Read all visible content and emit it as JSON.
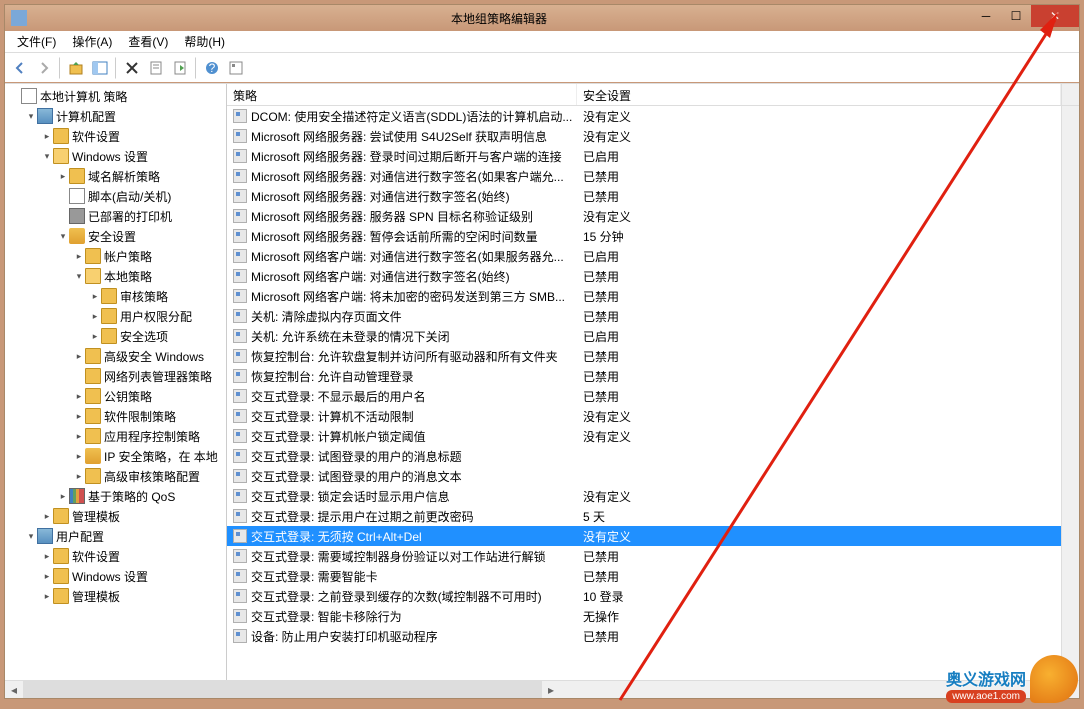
{
  "window": {
    "title": "本地组策略编辑器"
  },
  "menu": [
    {
      "label": "文件(F)"
    },
    {
      "label": "操作(A)"
    },
    {
      "label": "查看(V)"
    },
    {
      "label": "帮助(H)"
    }
  ],
  "tree": [
    {
      "indent": 0,
      "arrow": "",
      "icon": "doc",
      "label": "本地计算机 策略"
    },
    {
      "indent": 1,
      "arrow": "▾",
      "icon": "computer",
      "label": "计算机配置"
    },
    {
      "indent": 2,
      "arrow": "▸",
      "icon": "folder",
      "label": "软件设置"
    },
    {
      "indent": 2,
      "arrow": "▾",
      "icon": "folder-open",
      "label": "Windows 设置"
    },
    {
      "indent": 3,
      "arrow": "▸",
      "icon": "folder",
      "label": "域名解析策略"
    },
    {
      "indent": 3,
      "arrow": "",
      "icon": "doc",
      "label": "脚本(启动/关机)"
    },
    {
      "indent": 3,
      "arrow": "",
      "icon": "printer",
      "label": "已部署的打印机"
    },
    {
      "indent": 3,
      "arrow": "▾",
      "icon": "shield",
      "label": "安全设置"
    },
    {
      "indent": 4,
      "arrow": "▸",
      "icon": "folder",
      "label": "帐户策略"
    },
    {
      "indent": 4,
      "arrow": "▾",
      "icon": "folder-open",
      "label": "本地策略"
    },
    {
      "indent": 5,
      "arrow": "▸",
      "icon": "folder",
      "label": "审核策略"
    },
    {
      "indent": 5,
      "arrow": "▸",
      "icon": "folder",
      "label": "用户权限分配"
    },
    {
      "indent": 5,
      "arrow": "▸",
      "icon": "folder",
      "label": "安全选项"
    },
    {
      "indent": 4,
      "arrow": "▸",
      "icon": "folder",
      "label": "高级安全 Windows"
    },
    {
      "indent": 4,
      "arrow": "",
      "icon": "folder",
      "label": "网络列表管理器策略"
    },
    {
      "indent": 4,
      "arrow": "▸",
      "icon": "folder",
      "label": "公钥策略"
    },
    {
      "indent": 4,
      "arrow": "▸",
      "icon": "folder",
      "label": "软件限制策略"
    },
    {
      "indent": 4,
      "arrow": "▸",
      "icon": "folder",
      "label": "应用程序控制策略"
    },
    {
      "indent": 4,
      "arrow": "▸",
      "icon": "shield",
      "label": "IP 安全策略，在 本地"
    },
    {
      "indent": 4,
      "arrow": "▸",
      "icon": "folder",
      "label": "高级审核策略配置"
    },
    {
      "indent": 3,
      "arrow": "▸",
      "icon": "chart",
      "label": "基于策略的 QoS"
    },
    {
      "indent": 2,
      "arrow": "▸",
      "icon": "folder",
      "label": "管理模板"
    },
    {
      "indent": 1,
      "arrow": "▾",
      "icon": "computer",
      "label": "用户配置"
    },
    {
      "indent": 2,
      "arrow": "▸",
      "icon": "folder",
      "label": "软件设置"
    },
    {
      "indent": 2,
      "arrow": "▸",
      "icon": "folder",
      "label": "Windows 设置"
    },
    {
      "indent": 2,
      "arrow": "▸",
      "icon": "folder",
      "label": "管理模板"
    }
  ],
  "columns": {
    "c1": "策略",
    "c2": "安全设置"
  },
  "rows": [
    {
      "p": "DCOM: 使用安全描述符定义语言(SDDL)语法的计算机启动...",
      "s": "没有定义"
    },
    {
      "p": "Microsoft 网络服务器: 尝试使用 S4U2Self 获取声明信息",
      "s": "没有定义"
    },
    {
      "p": "Microsoft 网络服务器: 登录时间过期后断开与客户端的连接",
      "s": "已启用"
    },
    {
      "p": "Microsoft 网络服务器: 对通信进行数字签名(如果客户端允...",
      "s": "已禁用"
    },
    {
      "p": "Microsoft 网络服务器: 对通信进行数字签名(始终)",
      "s": "已禁用"
    },
    {
      "p": "Microsoft 网络服务器: 服务器 SPN 目标名称验证级别",
      "s": "没有定义"
    },
    {
      "p": "Microsoft 网络服务器: 暂停会话前所需的空闲时间数量",
      "s": "15 分钟"
    },
    {
      "p": "Microsoft 网络客户端: 对通信进行数字签名(如果服务器允...",
      "s": "已启用"
    },
    {
      "p": "Microsoft 网络客户端: 对通信进行数字签名(始终)",
      "s": "已禁用"
    },
    {
      "p": "Microsoft 网络客户端: 将未加密的密码发送到第三方 SMB...",
      "s": "已禁用"
    },
    {
      "p": "关机: 清除虚拟内存页面文件",
      "s": "已禁用"
    },
    {
      "p": "关机: 允许系统在未登录的情况下关闭",
      "s": "已启用"
    },
    {
      "p": "恢复控制台: 允许软盘复制并访问所有驱动器和所有文件夹",
      "s": "已禁用"
    },
    {
      "p": "恢复控制台: 允许自动管理登录",
      "s": "已禁用"
    },
    {
      "p": "交互式登录: 不显示最后的用户名",
      "s": "已禁用"
    },
    {
      "p": "交互式登录: 计算机不活动限制",
      "s": "没有定义"
    },
    {
      "p": "交互式登录: 计算机帐户锁定阈值",
      "s": "没有定义"
    },
    {
      "p": "交互式登录: 试图登录的用户的消息标题",
      "s": ""
    },
    {
      "p": "交互式登录: 试图登录的用户的消息文本",
      "s": ""
    },
    {
      "p": "交互式登录: 锁定会话时显示用户信息",
      "s": "没有定义"
    },
    {
      "p": "交互式登录: 提示用户在过期之前更改密码",
      "s": "5 天"
    },
    {
      "p": "交互式登录: 无须按 Ctrl+Alt+Del",
      "s": "没有定义",
      "selected": true
    },
    {
      "p": "交互式登录: 需要域控制器身份验证以对工作站进行解锁",
      "s": "已禁用"
    },
    {
      "p": "交互式登录: 需要智能卡",
      "s": "已禁用"
    },
    {
      "p": "交互式登录: 之前登录到缓存的次数(域控制器不可用时)",
      "s": "10 登录"
    },
    {
      "p": "交互式登录: 智能卡移除行为",
      "s": "无操作"
    },
    {
      "p": "设备: 防止用户安装打印机驱动程序",
      "s": "已禁用"
    }
  ],
  "watermark": {
    "site": "奥义游戏网",
    "url": "www.aoe1.com"
  }
}
